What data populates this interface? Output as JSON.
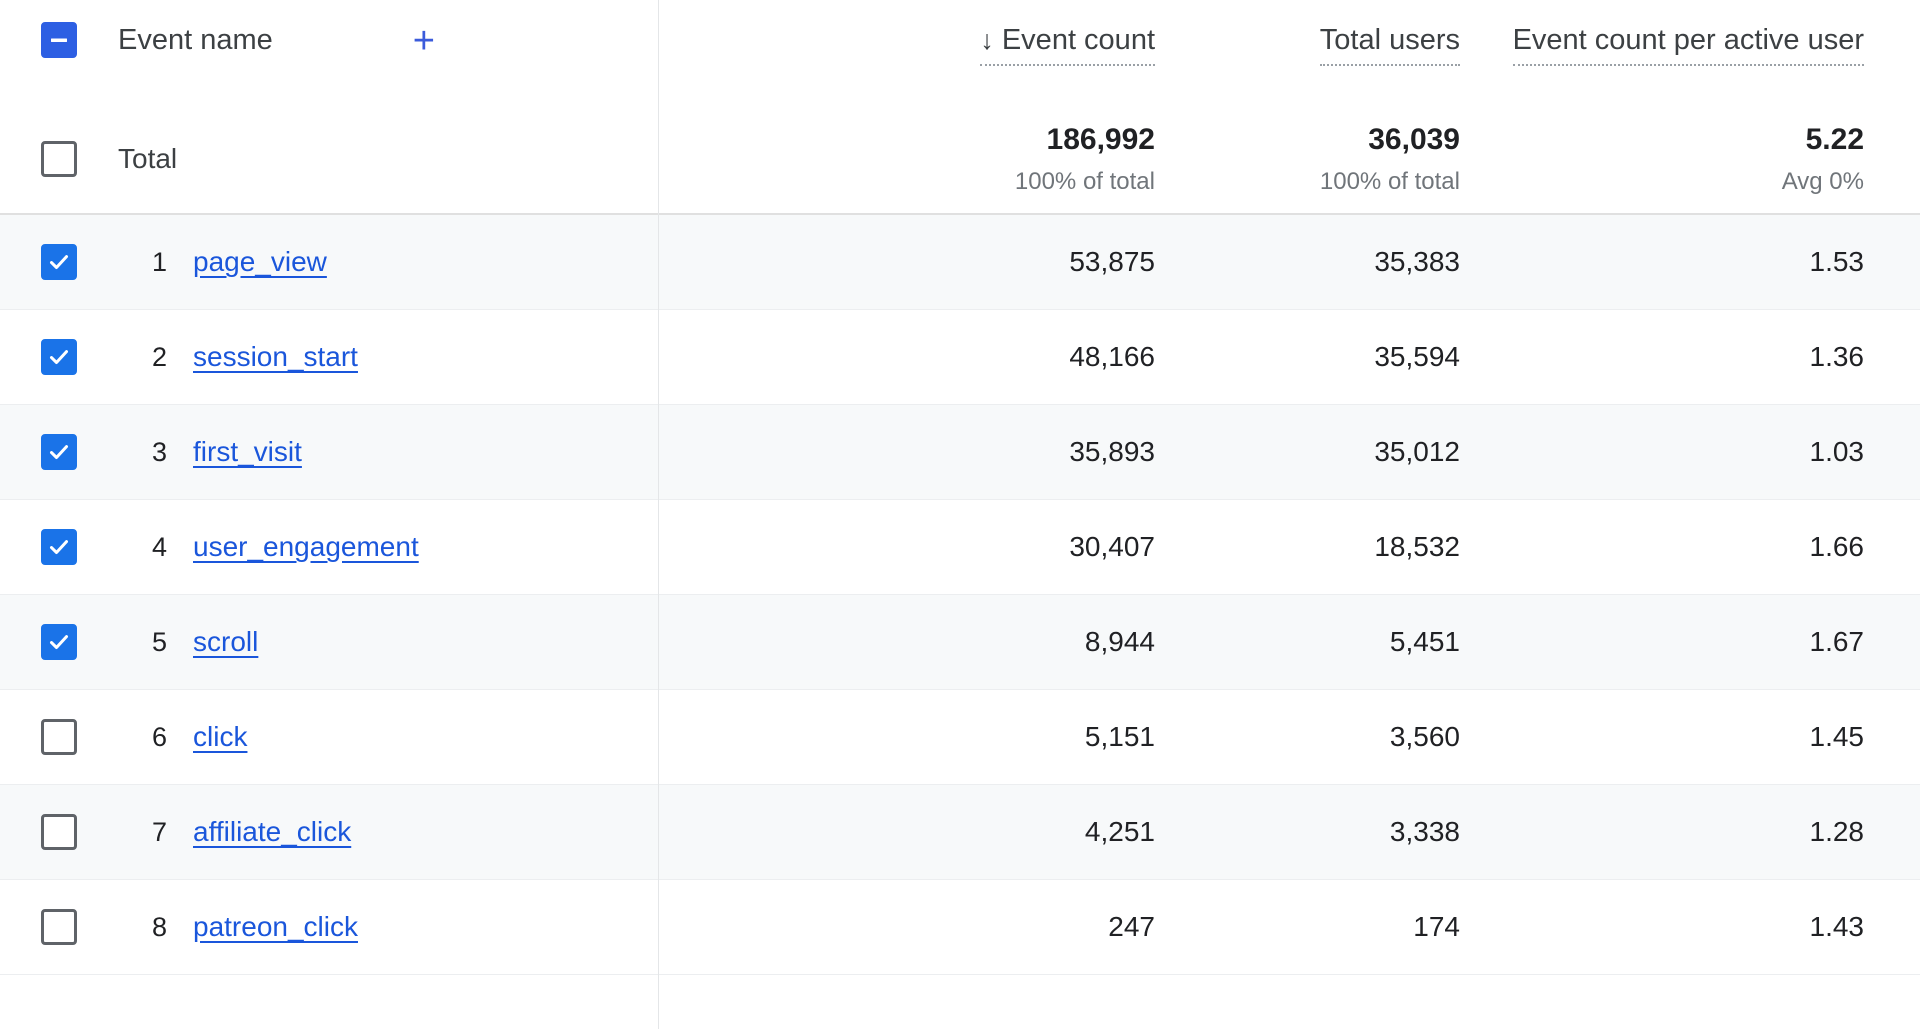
{
  "table": {
    "header": {
      "select_all_checkbox_state": "indeterminate",
      "dimension_label": "Event name",
      "add_dimension_icon": "+",
      "sort_arrow_icon": "↓",
      "metrics": [
        {
          "label": "Event count",
          "sorted": true
        },
        {
          "label": "Total users",
          "sorted": false
        },
        {
          "label": "Event count per active user",
          "sorted": false
        }
      ]
    },
    "total_row": {
      "checkbox_state": "unchecked",
      "label": "Total",
      "metrics": [
        {
          "value": "186,992",
          "sub": "100% of total"
        },
        {
          "value": "36,039",
          "sub": "100% of total"
        },
        {
          "value": "5.22",
          "sub": "Avg 0%"
        }
      ]
    },
    "rows": [
      {
        "index": "1",
        "checked": true,
        "shaded": true,
        "name": "page_view",
        "event_count": "53,875",
        "total_users": "35,383",
        "per_active_user": "1.53"
      },
      {
        "index": "2",
        "checked": true,
        "shaded": false,
        "name": "session_start",
        "event_count": "48,166",
        "total_users": "35,594",
        "per_active_user": "1.36"
      },
      {
        "index": "3",
        "checked": true,
        "shaded": true,
        "name": "first_visit",
        "event_count": "35,893",
        "total_users": "35,012",
        "per_active_user": "1.03"
      },
      {
        "index": "4",
        "checked": true,
        "shaded": false,
        "name": "user_engagement",
        "event_count": "30,407",
        "total_users": "18,532",
        "per_active_user": "1.66"
      },
      {
        "index": "5",
        "checked": true,
        "shaded": true,
        "name": "scroll",
        "event_count": "8,944",
        "total_users": "5,451",
        "per_active_user": "1.67"
      },
      {
        "index": "6",
        "checked": false,
        "shaded": false,
        "name": "click",
        "event_count": "5,151",
        "total_users": "3,560",
        "per_active_user": "1.45"
      },
      {
        "index": "7",
        "checked": false,
        "shaded": true,
        "name": "affiliate_click",
        "event_count": "4,251",
        "total_users": "3,338",
        "per_active_user": "1.28"
      },
      {
        "index": "8",
        "checked": false,
        "shaded": false,
        "name": "patreon_click",
        "event_count": "247",
        "total_users": "174",
        "per_active_user": "1.43"
      }
    ]
  },
  "colors": {
    "link": "#1a56db",
    "checkbox_checked": "#1a73e8",
    "checkbox_indeterminate": "#2d5fe3",
    "shaded_row": "#f7f9fa",
    "text_primary": "#202124",
    "text_secondary": "#70757a"
  }
}
